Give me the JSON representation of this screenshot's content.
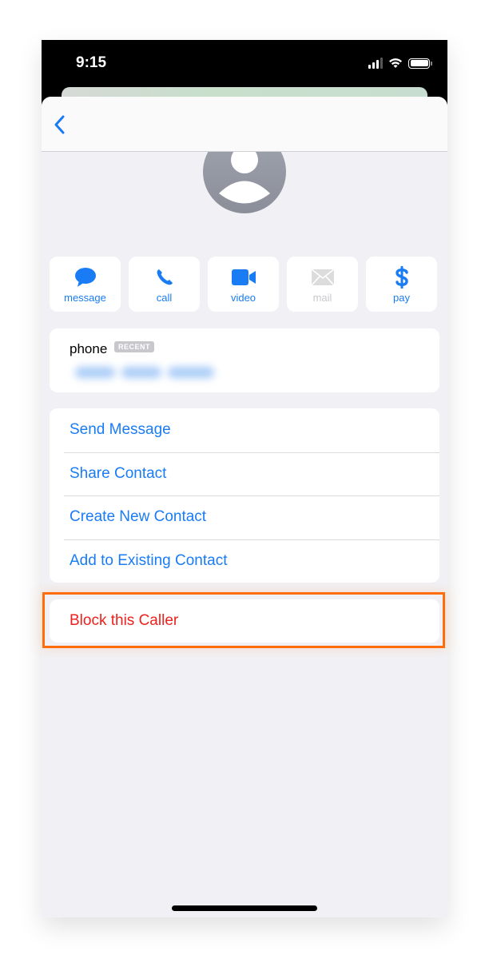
{
  "status_bar": {
    "time": "9:15",
    "icons": [
      "cellular-signal-icon",
      "wifi-icon",
      "battery-icon"
    ]
  },
  "nav": {
    "back_icon": "chevron-left-icon"
  },
  "contact": {
    "avatar_icon": "person-placeholder-icon"
  },
  "actions": [
    {
      "label": "message",
      "icon": "message-bubble-icon",
      "enabled": true
    },
    {
      "label": "call",
      "icon": "phone-icon",
      "enabled": true
    },
    {
      "label": "video",
      "icon": "video-camera-icon",
      "enabled": true
    },
    {
      "label": "mail",
      "icon": "envelope-icon",
      "enabled": false
    },
    {
      "label": "pay",
      "icon": "dollar-icon",
      "enabled": true
    }
  ],
  "phone_field": {
    "label": "phone",
    "badge": "RECENT",
    "number": "[blurred]"
  },
  "options": [
    "Send Message",
    "Share Contact",
    "Create New Contact",
    "Add to Existing Contact"
  ],
  "block": {
    "label": "Block this Caller",
    "highlight_color": "#ff6d0a"
  },
  "colors": {
    "accent": "#1a7cf5",
    "destructive": "#f0201c",
    "background": "#f1f1f5"
  }
}
